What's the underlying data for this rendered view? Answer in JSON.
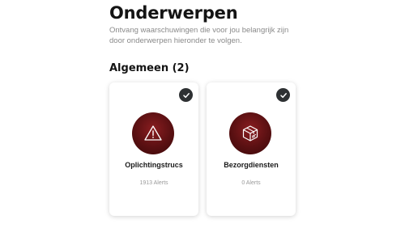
{
  "header": {
    "title": "Onderwerpen",
    "subtitle": "Ontvang waarschuwingen die voor jou belangrijk zijn door onderwerpen hieronder te volgen."
  },
  "section": {
    "title": "Algemeen (2)"
  },
  "colors": {
    "icon_background": "#6b1416",
    "check_background": "#2e3133"
  },
  "topics": [
    {
      "label": "Oplichtingstrucs",
      "count": "1913 Alerts",
      "icon": "warning-triangle-icon",
      "selected": true
    },
    {
      "label": "Bezorgdiensten",
      "count": "0 Alerts",
      "icon": "package-box-icon",
      "selected": true
    }
  ]
}
